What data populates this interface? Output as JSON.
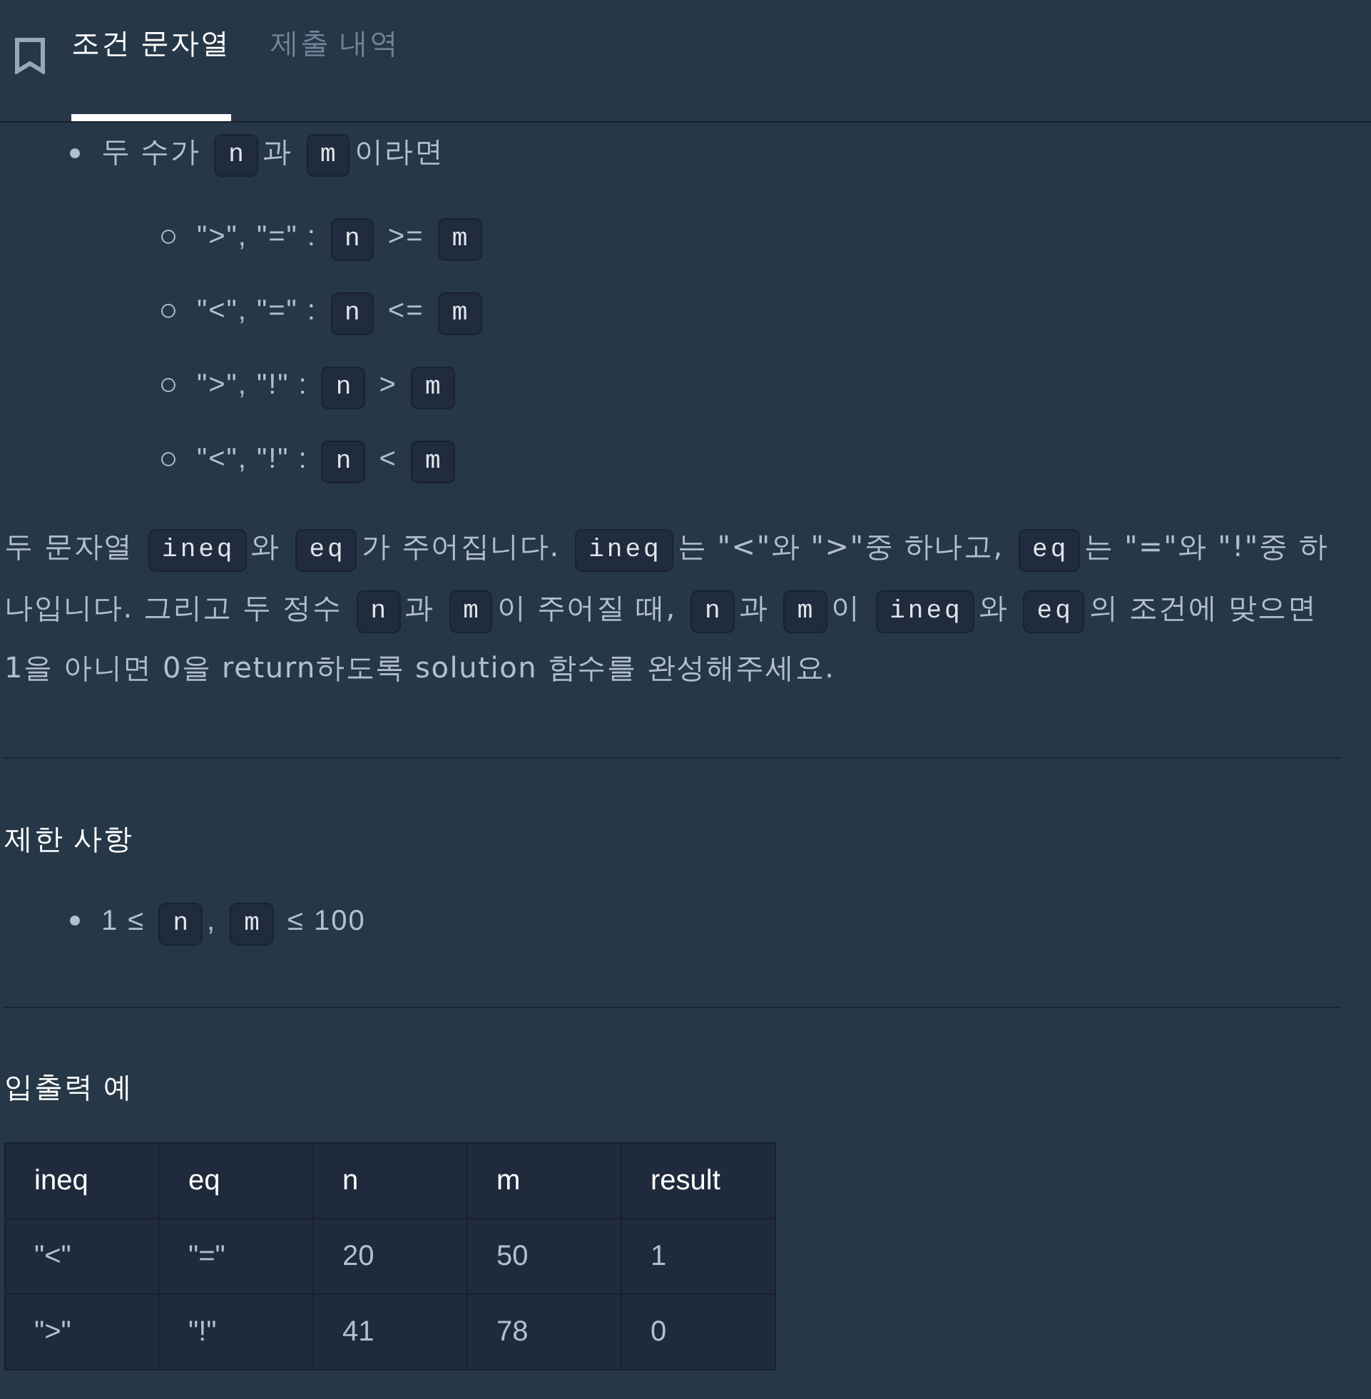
{
  "tabs": [
    {
      "label": "조건 문자열",
      "selected": true
    },
    {
      "label": "제출 내역",
      "selected": false
    }
  ],
  "conditions": [
    {
      "segments": [
        {
          "kind": "text",
          "text": "두 수가 "
        },
        {
          "kind": "code",
          "text": "n"
        },
        {
          "kind": "text",
          "text": "과 "
        },
        {
          "kind": "code",
          "text": "m"
        },
        {
          "kind": "text",
          "text": "이라면"
        }
      ],
      "children": [
        {
          "segments": [
            {
              "kind": "text",
              "text": "\">\", \"=\" : "
            },
            {
              "kind": "code",
              "text": "n"
            },
            {
              "kind": "text",
              "text": " >= "
            },
            {
              "kind": "code",
              "text": "m"
            }
          ]
        },
        {
          "segments": [
            {
              "kind": "text",
              "text": "\"<\", \"=\" : "
            },
            {
              "kind": "code",
              "text": "n"
            },
            {
              "kind": "text",
              "text": " <= "
            },
            {
              "kind": "code",
              "text": "m"
            }
          ]
        },
        {
          "segments": [
            {
              "kind": "text",
              "text": "\">\", \"!\" : "
            },
            {
              "kind": "code",
              "text": "n"
            },
            {
              "kind": "text",
              "text": " > "
            },
            {
              "kind": "code",
              "text": "m"
            }
          ]
        },
        {
          "segments": [
            {
              "kind": "text",
              "text": "\"<\", \"!\" : "
            },
            {
              "kind": "code",
              "text": "n"
            },
            {
              "kind": "text",
              "text": " < "
            },
            {
              "kind": "code",
              "text": "m"
            }
          ]
        }
      ]
    }
  ],
  "description": {
    "segments": [
      {
        "kind": "text",
        "text": "두 문자열 "
      },
      {
        "kind": "code",
        "text": "ineq"
      },
      {
        "kind": "text",
        "text": "와 "
      },
      {
        "kind": "code",
        "text": "eq"
      },
      {
        "kind": "text",
        "text": "가 주어집니다. "
      },
      {
        "kind": "code",
        "text": "ineq"
      },
      {
        "kind": "text",
        "text": "는 \"<\"와 \">\"중 하나고, "
      },
      {
        "kind": "code",
        "text": "eq"
      },
      {
        "kind": "text",
        "text": "는 \"=\"와 \"!\"중 하나입니다. 그리고 두 정수 "
      },
      {
        "kind": "code",
        "text": "n"
      },
      {
        "kind": "text",
        "text": "과 "
      },
      {
        "kind": "code",
        "text": "m"
      },
      {
        "kind": "text",
        "text": "이 주어질 때, "
      },
      {
        "kind": "code",
        "text": "n"
      },
      {
        "kind": "text",
        "text": "과 "
      },
      {
        "kind": "code",
        "text": "m"
      },
      {
        "kind": "text",
        "text": "이 "
      },
      {
        "kind": "code",
        "text": "ineq"
      },
      {
        "kind": "text",
        "text": "와 "
      },
      {
        "kind": "code",
        "text": "eq"
      },
      {
        "kind": "text",
        "text": "의 조건에 맞으면 1을 아니면 0을 return하도록 solution 함수를 완성해주세요."
      }
    ]
  },
  "restrictions": {
    "title": "제한 사항",
    "items": [
      {
        "segments": [
          {
            "kind": "text",
            "text": "1 ≤ "
          },
          {
            "kind": "code",
            "text": "n"
          },
          {
            "kind": "text",
            "text": ", "
          },
          {
            "kind": "code",
            "text": "m"
          },
          {
            "kind": "text",
            "text": " ≤ 100"
          }
        ]
      }
    ]
  },
  "examples": {
    "title": "입출력 예",
    "columns": [
      "ineq",
      "eq",
      "n",
      "m",
      "result"
    ],
    "rows": [
      [
        "\"<\"",
        "\"=\"",
        "20",
        "50",
        "1"
      ],
      [
        "\">\"",
        "\"!\"",
        "41",
        "78",
        "0"
      ]
    ]
  }
}
